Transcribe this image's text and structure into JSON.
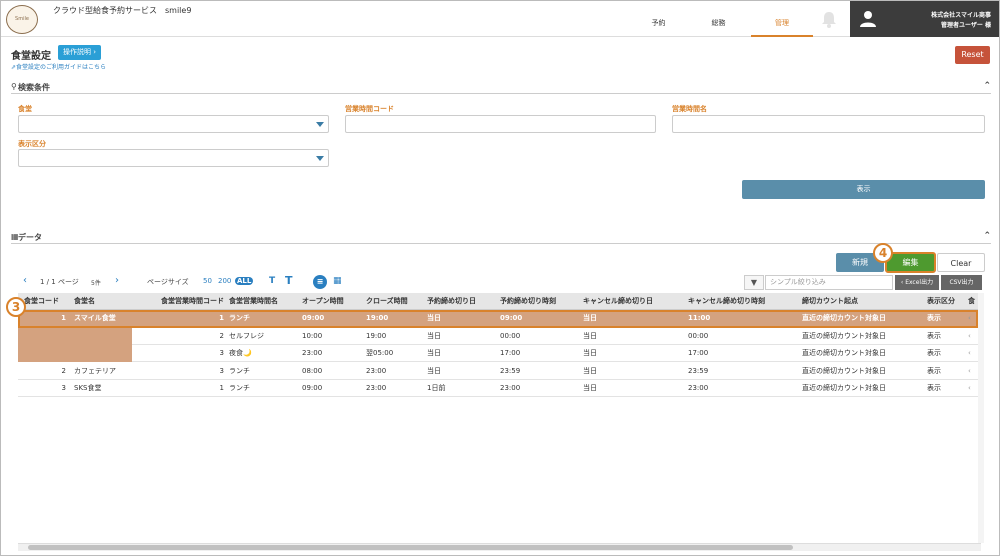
{
  "header": {
    "logo_text": "Smile",
    "app_title": "クラウド型給食予約サービス　smile9",
    "nav": {
      "yoyaku": "予約",
      "soumu": "総務",
      "kanri": "管理"
    },
    "company": "株式会社スマイル商事",
    "user": "管理者ユーザー 様"
  },
  "page": {
    "title": "食堂設定",
    "help_label": "操作説明 ›",
    "guide_link": "食堂設定のご利用ガイドはこちら",
    "reset_label": "Reset"
  },
  "search": {
    "section_title": "検索条件",
    "fields": {
      "cafeteria": "食堂",
      "hours_code": "営業時間コード",
      "hours_name": "営業時間名",
      "display_category": "表示区分"
    },
    "button_label": "表示"
  },
  "data": {
    "section_title": "データ",
    "new_label": "新規",
    "edit_label": "編集",
    "clear_label": "Clear",
    "callout_edit": "4",
    "callout_row": "3",
    "pager": {
      "page_text": "1 / 1 ページ",
      "count_text": "5件",
      "page_size_label": "ページサイズ",
      "size_50": "50",
      "size_200": "200",
      "size_all": "ALL"
    },
    "filter_placeholder": "シンプル絞り込み",
    "excel_label": "‹ Excel出力",
    "csv_label": "CSV出力",
    "columns": [
      "食堂コード",
      "食堂名",
      "食堂営業時間コード",
      "食堂営業時間名",
      "オープン時間",
      "クローズ時間",
      "予約締め切り日",
      "予約締め切り時刻",
      "キャンセル締め切り日",
      "キャンセル締め切り時刻",
      "締切カウント起点",
      "表示区分",
      "食"
    ],
    "rows": [
      {
        "code": "1",
        "name": "スマイル食堂",
        "hcode": "1",
        "hname": "ランチ",
        "open": "09:00",
        "close": "19:00",
        "rday": "当日",
        "rtime": "09:00",
        "cday": "当日",
        "ctime": "11:00",
        "base": "直近の締切カウント対象日",
        "disp": "表示",
        "more": "‹"
      },
      {
        "code": "",
        "name": "",
        "hcode": "2",
        "hname": "セルフレジ",
        "open": "10:00",
        "close": "19:00",
        "rday": "当日",
        "rtime": "00:00",
        "cday": "当日",
        "ctime": "00:00",
        "base": "直近の締切カウント対象日",
        "disp": "表示",
        "more": "‹"
      },
      {
        "code": "",
        "name": "",
        "hcode": "3",
        "hname": "夜食🌙",
        "open": "23:00",
        "close": "翌05:00",
        "rday": "当日",
        "rtime": "17:00",
        "cday": "当日",
        "ctime": "17:00",
        "base": "直近の締切カウント対象日",
        "disp": "表示",
        "more": "‹"
      },
      {
        "code": "2",
        "name": "カフェテリア",
        "hcode": "3",
        "hname": "ランチ",
        "open": "08:00",
        "close": "23:00",
        "rday": "当日",
        "rtime": "23:59",
        "cday": "当日",
        "ctime": "23:59",
        "base": "直近の締切カウント対象日",
        "disp": "表示",
        "more": "‹"
      },
      {
        "code": "3",
        "name": "SKS食堂",
        "hcode": "1",
        "hname": "ランチ",
        "open": "09:00",
        "close": "23:00",
        "rday": "1日前",
        "rtime": "23:00",
        "cday": "当日",
        "ctime": "23:00",
        "base": "直近の締切カウント対象日",
        "disp": "表示",
        "more": "‹"
      }
    ]
  },
  "colors": {
    "accent": "#d9822b",
    "primary": "#5a8eaa",
    "edit": "#4e9a2f",
    "danger": "#c6533a",
    "selected_row": "#d4a27f"
  }
}
